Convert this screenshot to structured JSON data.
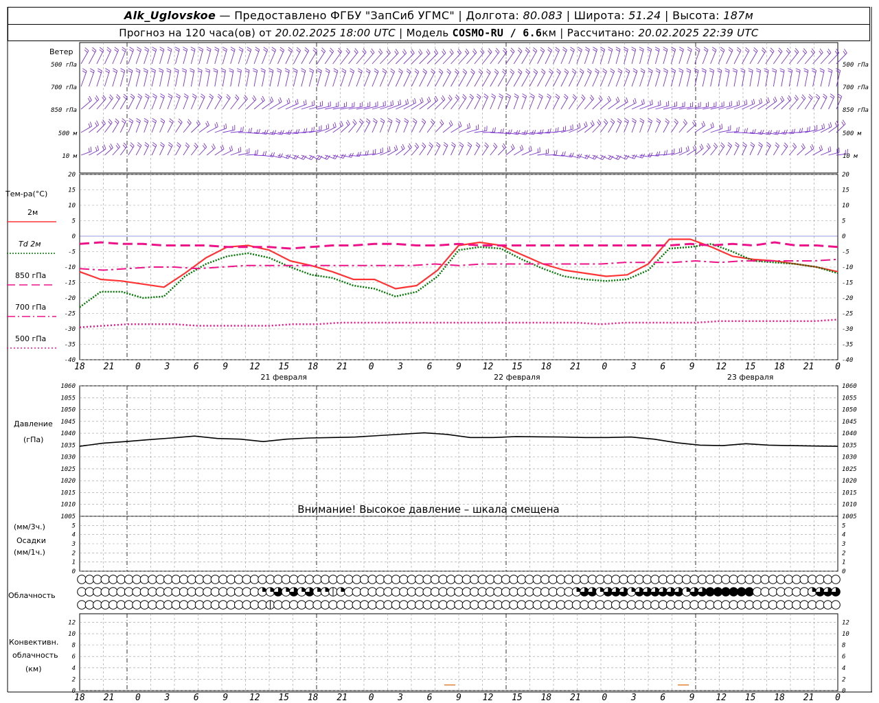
{
  "header": {
    "station": "Alk_Uglovskoe",
    "provider": "— Предоставлено ФГБУ \"ЗапСиб УГМС\"",
    "lon_label": "Долгота:",
    "lon": "80.083",
    "lat_label": "Широта:",
    "lat": "51.24",
    "alt_label": "Высота:",
    "alt": "187м",
    "forecast_label": "Прогноз на 120 часа(ов) от",
    "forecast_time": "20.02.2025 18:00 UTC",
    "model_label": "Модель",
    "model": "COSMO-RU / 6.6",
    "model_unit": "км",
    "computed_label": "Рассчитано:",
    "computed_time": "20.02.2025 22:39 UTC"
  },
  "wind": {
    "title": "Ветер",
    "levels": [
      "500 гПа",
      "700 гПа",
      "850 гПа",
      "500 м",
      "10  м"
    ]
  },
  "temp_panel": {
    "title": "Тем-ра(°C)",
    "legend": [
      {
        "label": "2м",
        "color": "#ff3333",
        "style": "solid"
      },
      {
        "label": "Td  2м",
        "color": "#007700",
        "style": "dotted"
      },
      {
        "label": "850 гПа",
        "color": "#ee1188",
        "style": "dash"
      },
      {
        "label": "700 гПа",
        "color": "#ee1188",
        "style": "dashdot"
      },
      {
        "label": "500 гПа",
        "color": "#ee1188",
        "style": "dot"
      }
    ],
    "yticks": [
      "20",
      "15",
      "10",
      "5",
      "0",
      "-5",
      "-10",
      "-15",
      "-20",
      "-25",
      "-30",
      "-35",
      "-40"
    ]
  },
  "x_axis": {
    "hour_labels": [
      "18",
      "21",
      "0",
      "3",
      "6",
      "9",
      "12",
      "15",
      "18",
      "21",
      "0",
      "3",
      "6",
      "9",
      "12",
      "15",
      "18",
      "21",
      "0",
      "3",
      "6",
      "9",
      "12",
      "15",
      "18",
      "21",
      "0"
    ],
    "day_labels": [
      "21 февраля",
      "22 февраля",
      "23 февраля"
    ]
  },
  "pressure_panel": {
    "title": "Давление",
    "unit": "(гПа)",
    "yticks": [
      "1060",
      "1055",
      "1050",
      "1045",
      "1040",
      "1035",
      "1030",
      "1025",
      "1020",
      "1015",
      "1010",
      "1005"
    ],
    "warning": "Внимание! Высокое давление – шкала смещена"
  },
  "precip_panel": {
    "unit_3h": "(мм/3ч.)",
    "title": "Осадки",
    "unit_1h": "(мм/1ч.)",
    "yticks": [
      "5",
      "4",
      "3",
      "2",
      "1",
      "0"
    ]
  },
  "cloud_panel": {
    "title": "Облачность"
  },
  "conv_panel": {
    "title_1": "Конвективн.",
    "title_2": "облачность",
    "unit": "(км)",
    "yticks": [
      "12",
      "10",
      "8",
      "6",
      "4",
      "2",
      "0"
    ]
  },
  "chart_data": {
    "type": "line",
    "x_hours_from_start": [
      0,
      3,
      6,
      9,
      12,
      15,
      18,
      21,
      24,
      27,
      30,
      33,
      36,
      39,
      42,
      45,
      48,
      51,
      54,
      57,
      60,
      63,
      66,
      69,
      72,
      75,
      78,
      81,
      84,
      87,
      90,
      93,
      96
    ],
    "series": [
      {
        "name": "2м",
        "color": "#ff3333",
        "values": [
          -11.5,
          -14,
          -14.5,
          -15.5,
          -16.5,
          -12,
          -7,
          -3.5,
          -3,
          -4.5,
          -8,
          -9.5,
          -11.5,
          -14,
          -14,
          -17,
          -16,
          -11,
          -3,
          -2,
          -3,
          -6,
          -9,
          -11,
          -12,
          -13,
          -12.5,
          -9,
          -1,
          -1,
          -3.5,
          -6.5,
          -7.5,
          -8,
          -9,
          -10,
          -11.5
        ]
      },
      {
        "name": "Td  2м",
        "color": "#007700",
        "values": [
          -23,
          -18,
          -18,
          -20,
          -19.5,
          -13,
          -9,
          -6.5,
          -5.5,
          -7,
          -10,
          -12.5,
          -13.5,
          -16,
          -17,
          -19.5,
          -18,
          -13,
          -4.5,
          -3.5,
          -4,
          -7.5,
          -10.5,
          -13,
          -14,
          -14.5,
          -14,
          -11,
          -4,
          -3.5,
          -2.5,
          -5,
          -8,
          -8.5,
          -9,
          -10,
          -12
        ]
      },
      {
        "name": "850 гПа",
        "color": "#ee1188",
        "values": [
          -2.5,
          -2,
          -2.5,
          -2.5,
          -3,
          -3,
          -3,
          -3.5,
          -3.5,
          -3.5,
          -4,
          -3.5,
          -3,
          -3,
          -2.5,
          -2.5,
          -3,
          -3,
          -2.5,
          -3,
          -3,
          -3,
          -3,
          -3,
          -3,
          -3,
          -3,
          -3,
          -3,
          -2.5,
          -3,
          -2.5,
          -3,
          -2,
          -3,
          -3,
          -3.5
        ]
      },
      {
        "name": "700 гПа",
        "color": "#ee1188",
        "values": [
          -10.5,
          -11,
          -10.5,
          -10,
          -10,
          -10.5,
          -10,
          -9.5,
          -9.5,
          -9.5,
          -9.5,
          -9.5,
          -9.5,
          -9.5,
          -9.5,
          -9,
          -9.5,
          -9,
          -9,
          -9,
          -9,
          -9,
          -9,
          -8.5,
          -8.5,
          -8.5,
          -8,
          -8.5,
          -8,
          -8,
          -8,
          -8,
          -7.5
        ]
      },
      {
        "name": "500 гПа",
        "color": "#ee1188",
        "values": [
          -29.5,
          -29,
          -28.5,
          -28.5,
          -28.5,
          -29,
          -29,
          -29,
          -29,
          -28.5,
          -28.5,
          -28,
          -28,
          -28,
          -28,
          -28,
          -28,
          -28,
          -28,
          -28,
          -28,
          -28,
          -28.5,
          -28,
          -28,
          -28,
          -28,
          -27.5,
          -27.5,
          -27.5,
          -27.5,
          -27.5,
          -27
        ]
      },
      {
        "name": "Давление",
        "color": "#000000",
        "values": [
          1034.5,
          1035.8,
          1036.5,
          1037.3,
          1038,
          1038.8,
          1037.8,
          1037.5,
          1036.5,
          1037.5,
          1038,
          1038.2,
          1038.4,
          1039,
          1039.6,
          1040.2,
          1039.5,
          1038.2,
          1038.2,
          1038.6,
          1038.5,
          1038.4,
          1038.2,
          1038.2,
          1038.4,
          1037.5,
          1036,
          1035,
          1034.8,
          1035.6,
          1035,
          1034.8,
          1034.6,
          1034.5
        ]
      }
    ],
    "temp_ylim": [
      -40,
      20
    ],
    "pressure_ylim": [
      1005,
      1060
    ],
    "precip_ylim": [
      0,
      5
    ],
    "conv_ylim": [
      0,
      13
    ],
    "conv_marks": [
      {
        "hour": 63,
        "value": 1
      },
      {
        "hour": 111,
        "value": 1
      }
    ],
    "cloud_rows": [
      [
        0,
        0,
        0,
        0,
        0,
        0,
        0,
        0,
        0,
        0,
        0,
        0,
        0,
        0,
        0,
        0,
        0,
        0,
        0,
        0,
        0,
        0,
        0,
        0,
        0,
        0,
        0,
        0,
        0,
        0,
        0,
        0,
        0,
        0,
        0,
        0,
        0,
        0,
        0,
        0,
        0,
        0,
        0,
        0,
        0,
        0,
        0,
        0,
        0,
        0,
        0,
        0,
        0,
        0,
        0,
        0,
        0,
        0,
        0,
        0,
        0,
        0,
        0,
        0,
        0,
        0,
        0,
        0,
        0,
        0,
        0,
        0,
        0,
        0,
        0,
        0,
        0,
        0,
        0,
        0,
        0,
        0,
        0,
        0,
        0,
        0,
        0,
        0,
        0,
        0,
        0,
        0,
        0,
        0,
        0,
        0,
        0,
        0,
        0
      ],
      [
        0,
        0,
        0,
        0,
        0,
        0,
        0,
        0,
        0,
        0,
        0,
        0,
        0,
        0,
        0,
        0,
        0,
        0,
        0,
        0,
        0,
        0,
        0,
        2,
        2,
        3,
        2,
        3,
        2,
        3,
        2,
        2,
        1,
        2,
        0,
        0,
        0,
        0,
        0,
        0,
        0,
        0,
        0,
        0,
        0,
        0,
        0,
        0,
        0,
        0,
        0,
        0,
        0,
        0,
        0,
        0,
        0,
        0,
        0,
        0,
        0,
        0,
        0,
        2,
        3,
        3,
        2,
        3,
        3,
        3,
        2,
        3,
        3,
        3,
        3,
        3,
        3,
        2,
        3,
        3,
        4,
        4,
        4,
        4,
        4,
        4,
        0,
        0,
        0,
        0,
        0,
        0,
        0,
        2,
        3,
        3,
        3,
        3,
        3,
        3,
        3,
        3,
        3,
        3,
        4,
        4,
        4,
        3,
        3,
        4,
        4
      ],
      [
        0,
        0,
        0,
        0,
        0,
        0,
        0,
        0,
        0,
        0,
        0,
        0,
        0,
        0,
        0,
        0,
        0,
        0,
        0,
        0,
        0,
        0,
        0,
        0,
        1,
        0,
        0,
        0,
        0,
        0,
        0,
        0,
        0,
        0,
        0,
        0,
        0,
        0,
        0,
        0,
        0,
        0,
        0,
        0,
        0,
        0,
        0,
        0,
        0,
        0,
        0,
        0,
        0,
        0,
        0,
        0,
        0,
        0,
        0,
        0,
        0,
        0,
        0,
        0,
        0,
        0,
        0,
        0,
        0,
        0,
        0,
        0,
        0,
        0,
        0,
        0,
        0,
        0,
        0,
        0,
        0,
        0,
        0,
        0,
        0,
        0,
        0,
        0,
        0,
        0,
        0,
        0,
        0,
        0,
        0,
        0,
        0,
        0,
        0,
        0,
        0,
        0,
        0,
        0,
        0,
        0,
        0,
        0,
        0,
        0,
        0
      ]
    ]
  }
}
